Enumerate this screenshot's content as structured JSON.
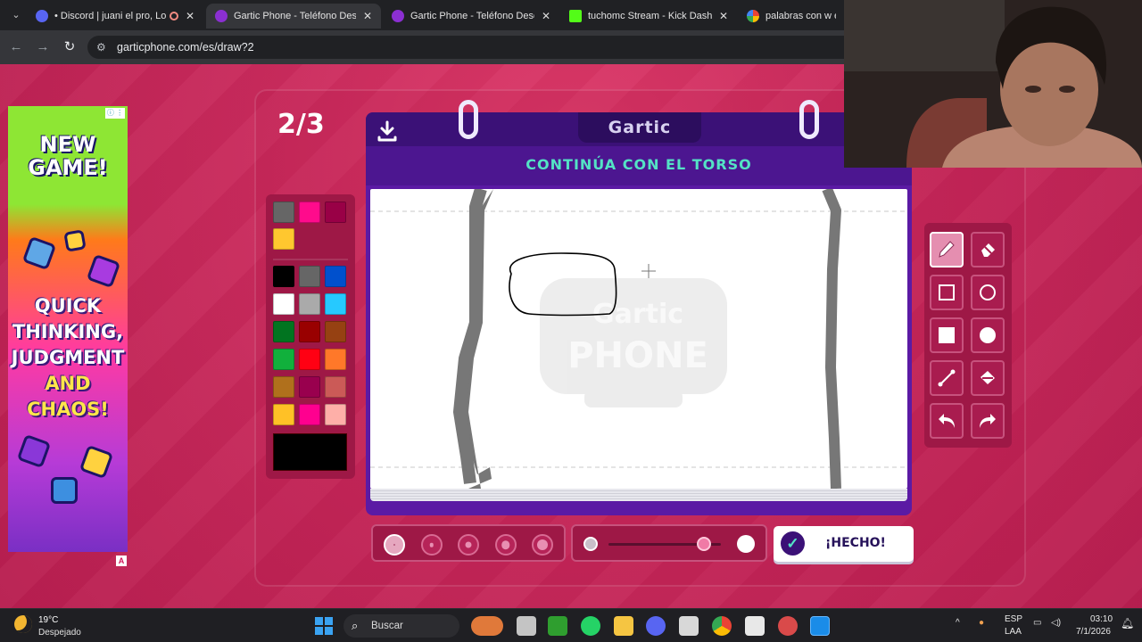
{
  "browser": {
    "tabs": [
      {
        "title": "• Discord | juani el pro, Lov",
        "favicon_color": "#5865f2",
        "close": "✕",
        "active": false
      },
      {
        "title": "Gartic Phone - Teléfono Descon",
        "favicon_color": "#8b2fd1",
        "close": "✕",
        "active": true
      },
      {
        "title": "Gartic Phone - Teléfono Descon",
        "favicon_color": "#8b2fd1",
        "close": "✕",
        "active": false
      },
      {
        "title": "tuchomc Stream - Kick Dashbo",
        "favicon_color": "#53fc18",
        "close": "✕",
        "active": false
      },
      {
        "title": "palabras con w en es",
        "favicon_color": "#ffffff",
        "close": "",
        "active": false
      }
    ],
    "url": "garticphone.com/es/draw?2"
  },
  "ad": {
    "headline": "NEW GAME!",
    "body_line1": "QUICK",
    "body_line2": "THINKING,",
    "body_line3": "JUDGMENT",
    "body_line4": "AND",
    "body_line5": "CHAOS!",
    "choices_label": "A"
  },
  "game": {
    "round": "2/3",
    "logo": "Gartic",
    "prompt": "CONTINÚA CON EL TORSO",
    "done_label": "¡HECHO!",
    "watermark_line1": "Gartic",
    "watermark_line2": "PHONE",
    "palette": [
      "#666666",
      "#ff0b8c",
      "#990046",
      "#ffc72f",
      "#000000",
      "#666666",
      "#0050cd",
      "#ffffff",
      "#aaaaaa",
      "#26c9ff",
      "#017420",
      "#990000",
      "#964112",
      "#11b03c",
      "#ff0013",
      "#ff7829",
      "#b0701c",
      "#99004e",
      "#cb5a57",
      "#ffc126",
      "#ff008f",
      "#feafa8"
    ],
    "current_color": "#000000",
    "tools": [
      "pencil",
      "eraser",
      "rect-outline",
      "ellipse-outline",
      "rect-fill",
      "ellipse-fill",
      "line",
      "bucket",
      "undo",
      "redo"
    ],
    "brush_sizes": 5,
    "selected_size": 1,
    "opacity": 0.85
  },
  "taskbar": {
    "temp": "19°C",
    "weather": "Despejado",
    "search": "Buscar",
    "lang1": "ESP",
    "lang2": "LAA",
    "time": "03:10",
    "date": "7/1/2026"
  }
}
